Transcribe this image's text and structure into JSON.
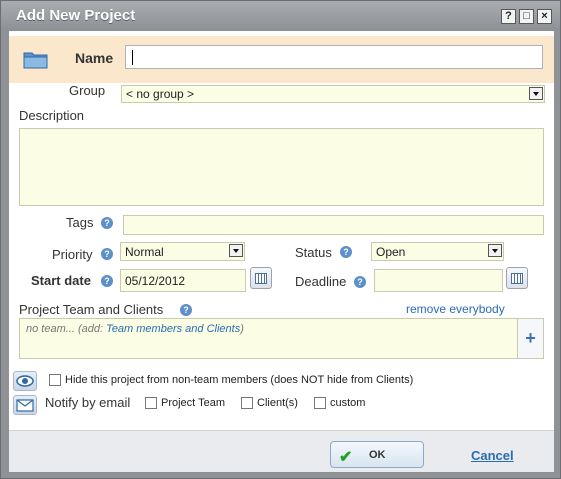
{
  "window": {
    "title": "Add New Project",
    "buttons": {
      "help": "?",
      "maximize": "□",
      "close": "×"
    }
  },
  "form": {
    "name": {
      "label": "Name",
      "value": ""
    },
    "group": {
      "label": "Group",
      "value": "< no group >"
    },
    "description": {
      "label": "Description",
      "value": ""
    },
    "tags": {
      "label": "Tags",
      "value": ""
    },
    "priority": {
      "label": "Priority",
      "value": "Normal"
    },
    "status": {
      "label": "Status",
      "value": "Open"
    },
    "start_date": {
      "label": "Start date",
      "value": "05/12/2012"
    },
    "deadline": {
      "label": "Deadline",
      "value": ""
    },
    "team": {
      "label": "Project Team and Clients",
      "remove_link": "remove everybody",
      "empty_text": "no team... (add: ",
      "add_link": "Team members and Clients",
      "empty_suffix": ")",
      "add_button": "+"
    },
    "hide_option": {
      "label": "Hide this project from non-team members (does NOT hide from Clients)",
      "checked": false
    },
    "notify": {
      "label": "Notify by email",
      "options": [
        {
          "label": "Project Team",
          "checked": false
        },
        {
          "label": "Client(s)",
          "checked": false
        },
        {
          "label": "custom",
          "checked": false
        }
      ]
    },
    "help_icon": "?"
  },
  "footer": {
    "ok_label": "OK",
    "ok_icon": "✔",
    "cancel_label": "Cancel"
  },
  "colors": {
    "name_bar": "#fbe7cc",
    "field_bg": "#fbfde4",
    "link": "#2a6cb3",
    "ok_check": "#22a12a"
  }
}
